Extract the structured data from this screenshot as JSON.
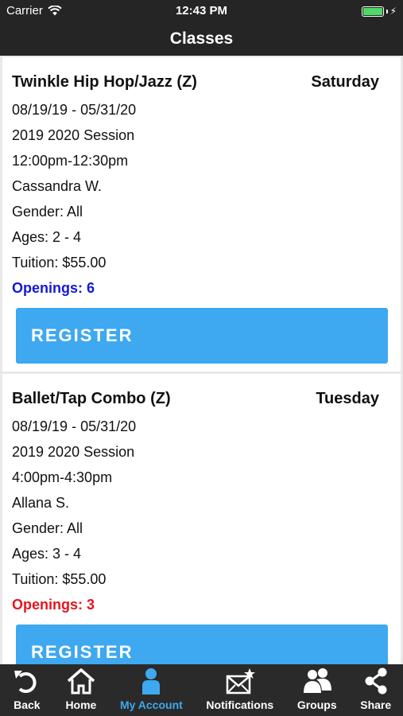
{
  "status_bar": {
    "carrier": "Carrier",
    "time": "12:43 PM"
  },
  "nav": {
    "title": "Classes"
  },
  "classes": [
    {
      "name": "Twinkle Hip Hop/Jazz (Z)",
      "day": "Saturday",
      "dates": "08/19/19 - 05/31/20",
      "session": "2019 2020 Session",
      "time": "12:00pm-12:30pm",
      "instructor": "Cassandra W.",
      "gender": "Gender: All",
      "ages": "Ages: 2 - 4",
      "tuition": "Tuition: $55.00",
      "openings": "Openings: 6",
      "openings_color": "#1518d6",
      "register_label": "REGISTER"
    },
    {
      "name": "Ballet/Tap Combo (Z)",
      "day": "Tuesday",
      "dates": "08/19/19 - 05/31/20",
      "session": "2019 2020 Session",
      "time": "4:00pm-4:30pm",
      "instructor": "Allana S.",
      "gender": "Gender: All",
      "ages": "Ages: 3 - 4",
      "tuition": "Tuition: $55.00",
      "openings": "Openings: 3",
      "openings_color": "#e8141e",
      "register_label": "REGISTER"
    }
  ],
  "tab_bar": {
    "active_color": "#3ea8f0",
    "items": [
      {
        "label": "Back",
        "icon": "back-icon"
      },
      {
        "label": "Home",
        "icon": "home-icon"
      },
      {
        "label": "My Account",
        "icon": "user-icon",
        "active": true
      },
      {
        "label": "Notifications",
        "icon": "notifications-icon"
      },
      {
        "label": "Groups",
        "icon": "groups-icon"
      },
      {
        "label": "Share",
        "icon": "share-icon"
      }
    ]
  }
}
